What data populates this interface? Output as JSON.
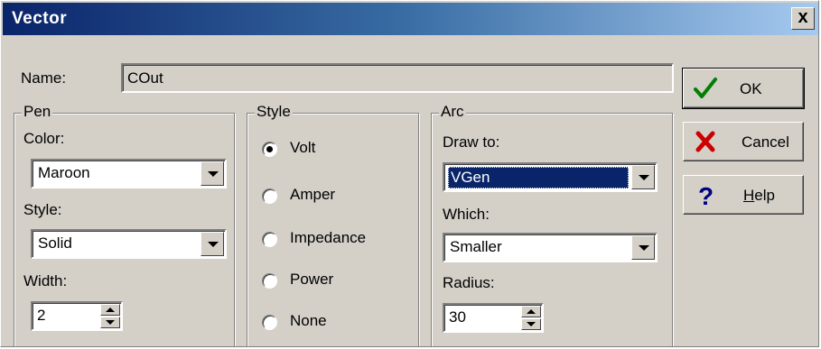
{
  "window": {
    "title": "Vector",
    "close_label": "x"
  },
  "name": {
    "label": "Name:",
    "value": "COut"
  },
  "pen": {
    "group_title": "Pen",
    "color_label": "Color:",
    "color_value": "Maroon",
    "style_label": "Style:",
    "style_value": "Solid",
    "width_label": "Width:",
    "width_value": "2"
  },
  "style": {
    "group_title": "Style",
    "options": [
      {
        "label": "Volt",
        "checked": true
      },
      {
        "label": "Amper",
        "checked": false
      },
      {
        "label": "Impedance",
        "checked": false
      },
      {
        "label": "Power",
        "checked": false
      },
      {
        "label": "None",
        "checked": false
      }
    ]
  },
  "arc": {
    "group_title": "Arc",
    "draw_to_label": "Draw to:",
    "draw_to_value": "VGen",
    "which_label": "Which:",
    "which_value": "Smaller",
    "radius_label": "Radius:",
    "radius_value": "30"
  },
  "buttons": {
    "ok": {
      "label": "OK",
      "icon": "green-check-icon",
      "color": "#008000"
    },
    "cancel": {
      "label": "Cancel",
      "icon": "red-x-icon",
      "color": "#cc0000"
    },
    "help": {
      "prefix": "",
      "underlined": "H",
      "rest": "elp",
      "icon": "question-mark-icon",
      "color": "#000080"
    }
  }
}
